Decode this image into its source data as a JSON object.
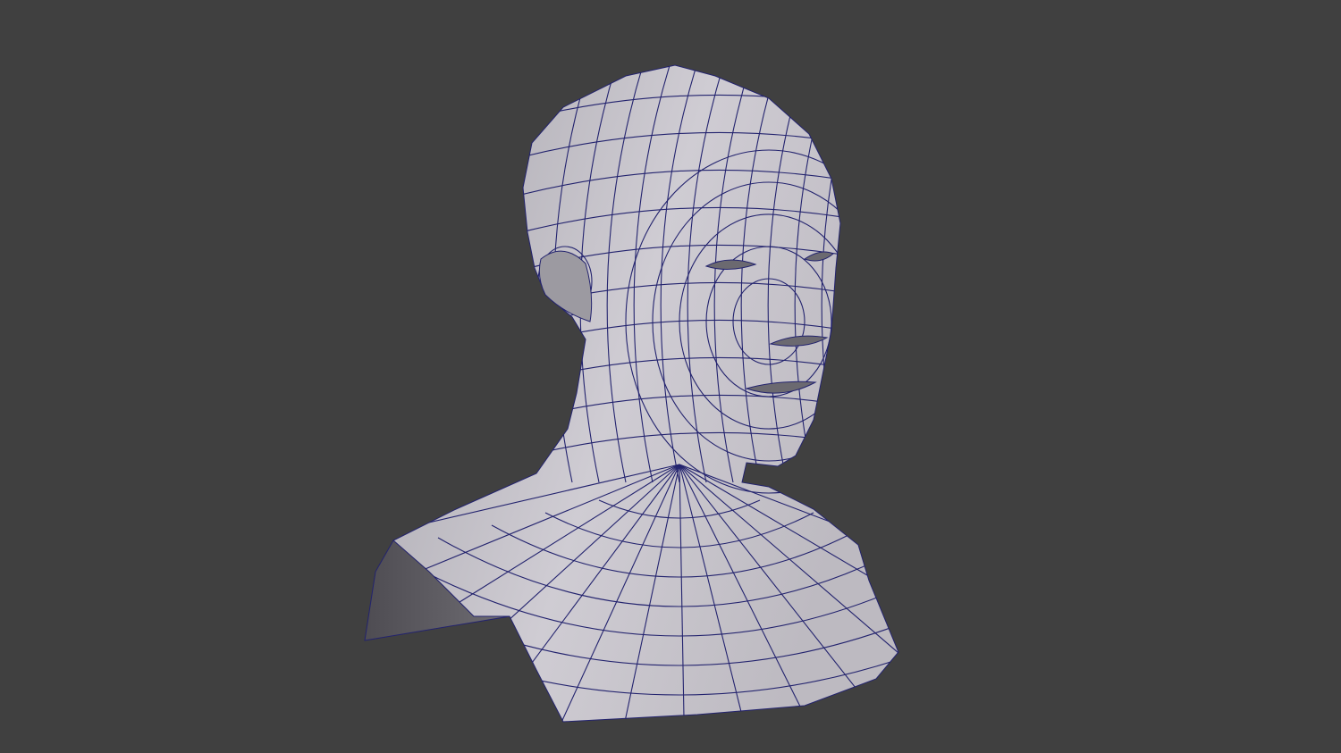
{
  "scene": {
    "subject": "head-bust-mesh",
    "colors": {
      "background": "#404040",
      "surface_light": "#d4d1d8",
      "surface_mid": "#b3b1b8",
      "surface_dark": "#5e5c62",
      "wire": "#23236e"
    }
  }
}
